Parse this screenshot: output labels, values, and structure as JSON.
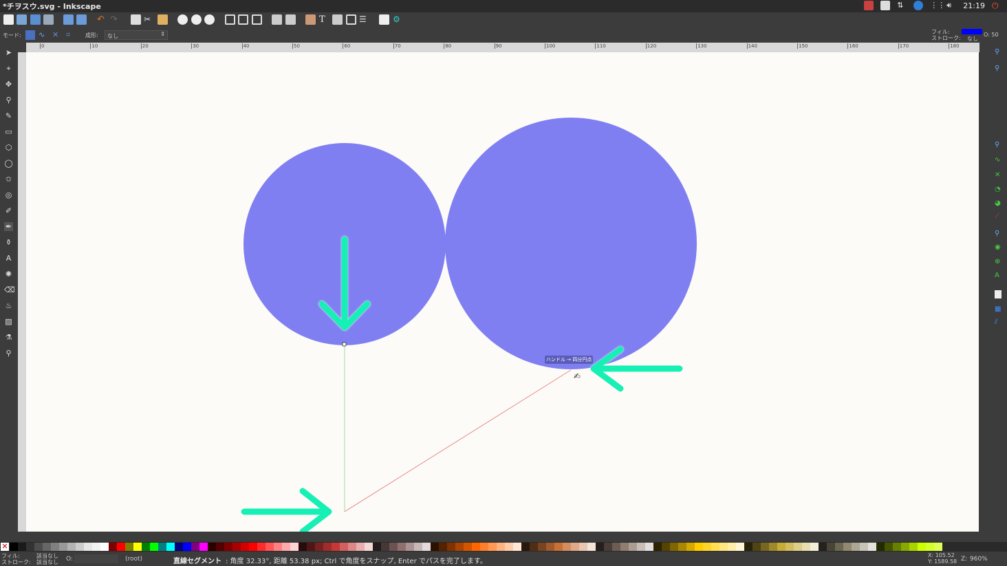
{
  "window": {
    "title": "*チヲスウ.svg - Inkscape"
  },
  "systray": {
    "clock": "21:19"
  },
  "controls": {
    "mode_label": "モード:",
    "shape_label": "成形:",
    "shape_value": "なし",
    "fill_label": "フィル:",
    "stroke_label": "ストローク:",
    "stroke_value": "なし",
    "opacity_label": "O: 50",
    "fill_color": "#0000ff"
  },
  "ruler": {
    "ticks": [
      "0",
      "10",
      "20",
      "30",
      "40",
      "50",
      "60",
      "70",
      "80",
      "90",
      "100",
      "110",
      "120",
      "130",
      "140",
      "150",
      "160",
      "170",
      "180"
    ]
  },
  "canvas": {
    "circle_color": "#7f7ff2",
    "snap_tooltip": "ハンドル → 四分円点",
    "arrow_color": "#19f0b4"
  },
  "status": {
    "fill_label": "フィル:",
    "stroke_label": "ストローク:",
    "fill_value": "該当なし",
    "stroke_value": "該当なし",
    "opacity_label": "O:",
    "layer": "(root)",
    "message_bold": "直線セグメント",
    "message": ": 角度 32.33°, 距離 53.38 px; Ctrl で角度をスナップ, Enter でパスを完了します。",
    "x_coord": "X: 105.52",
    "y_coord": "Y: 1589.58",
    "zoom_label": "Z:",
    "zoom": "960%"
  },
  "palette": [
    "#000000",
    "#1a1a1a",
    "#333333",
    "#4d4d4d",
    "#666666",
    "#808080",
    "#999999",
    "#b3b3b3",
    "#cccccc",
    "#e6e6e6",
    "#f2f2f2",
    "#ffffff",
    "#800000",
    "#ff0000",
    "#808000",
    "#ffff00",
    "#008000",
    "#00ff00",
    "#008080",
    "#00ffff",
    "#000080",
    "#0000ff",
    "#800080",
    "#ff00ff",
    "#2b0000",
    "#550000",
    "#800000",
    "#aa0000",
    "#d40000",
    "#ff0000",
    "#ff2a2a",
    "#ff5555",
    "#ff8080",
    "#ffaaaa",
    "#ffd5d5",
    "#280b0b",
    "#501616",
    "#782121",
    "#a02c2c",
    "#c83737",
    "#d35f5f",
    "#de8787",
    "#e9afaf",
    "#f4d7d7",
    "#241c1c",
    "#483737",
    "#6c5353",
    "#916f6f",
    "#ac9393",
    "#c8b7b7",
    "#e3dbdb",
    "#2b1100",
    "#552200",
    "#803300",
    "#aa4400",
    "#d45500",
    "#ff6600",
    "#ff7f2a",
    "#ff9955",
    "#ffb380",
    "#ffccaa",
    "#ffe6d5",
    "#28170b",
    "#502d16",
    "#784421",
    "#a05a2c",
    "#c87137",
    "#d38d5f",
    "#deaa87",
    "#e9c6af",
    "#f4e3d7",
    "#241f1c",
    "#483e37",
    "#6c5d53",
    "#917c6f",
    "#ac9d93",
    "#c8beb7",
    "#e3dedb",
    "#2b2200",
    "#554400",
    "#806600",
    "#aa8800",
    "#d4aa00",
    "#ffcc00",
    "#ffd42a",
    "#ffdd55",
    "#ffe680",
    "#ffeeaa",
    "#fff6d5",
    "#28220b",
    "#504416",
    "#786721",
    "#a0892c",
    "#c8ab37",
    "#d3bc5f",
    "#decd87",
    "#e9ddaf",
    "#f4eed7",
    "#24221c",
    "#484537",
    "#6c6753",
    "#918a6f",
    "#aca793",
    "#c8c4b7",
    "#e3e2db",
    "#222b00",
    "#445500",
    "#668000",
    "#88aa00",
    "#aad400",
    "#ccff00",
    "#d4ff2a",
    "#ddff55"
  ]
}
